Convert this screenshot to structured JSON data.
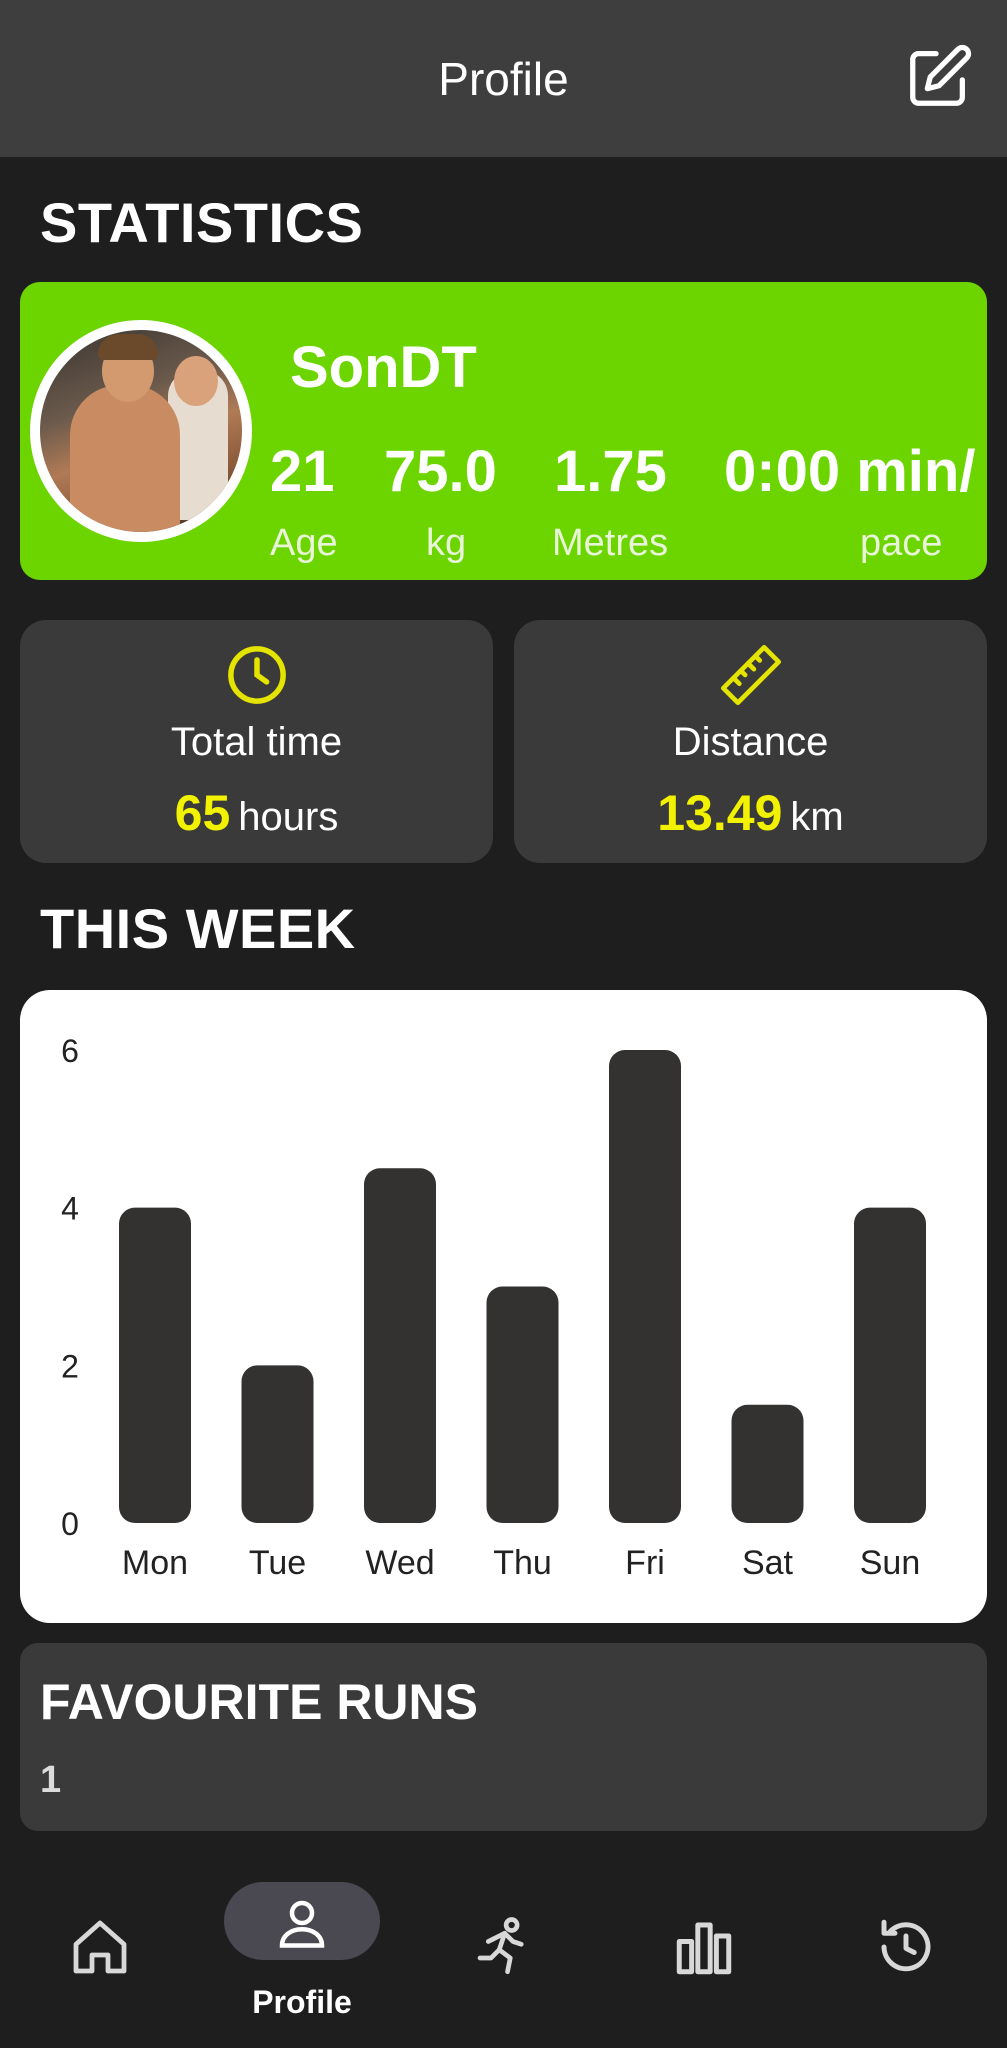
{
  "header": {
    "title": "Profile",
    "edit_icon": "edit-icon"
  },
  "statistics": {
    "section_title": "STATISTICS",
    "username": "SonDT",
    "stats": [
      {
        "value": "21",
        "label": "Age"
      },
      {
        "value": "75.0",
        "label": "kg"
      },
      {
        "value": "1.75",
        "label": "Metres"
      },
      {
        "value": "0:00 min/",
        "label": "pace"
      }
    ],
    "card_color": "#6cd500"
  },
  "tiles": {
    "total_time": {
      "label": "Total time",
      "value": "65",
      "unit": "hours",
      "icon": "clock-icon"
    },
    "distance": {
      "label": "Distance",
      "value": "13.49",
      "unit": "km",
      "icon": "ruler-icon"
    },
    "accent_color": "#f2f200"
  },
  "this_week": {
    "section_title": "THIS WEEK",
    "chart_data": {
      "type": "bar",
      "categories": [
        "Mon",
        "Tue",
        "Wed",
        "Thu",
        "Fri",
        "Sat",
        "Sun"
      ],
      "values": [
        4,
        2,
        4.5,
        3,
        6,
        1.5,
        4
      ],
      "yticks": [
        0,
        2,
        4,
        6
      ],
      "ylim": [
        0,
        6
      ],
      "bar_color": "#333230"
    }
  },
  "favourite_runs": {
    "title": "FAVOURITE RUNS",
    "count": "1"
  },
  "nav": {
    "items": [
      {
        "icon": "home-icon",
        "label": ""
      },
      {
        "icon": "profile-icon",
        "label": "Profile",
        "active": true
      },
      {
        "icon": "run-icon",
        "label": ""
      },
      {
        "icon": "bar-chart-icon",
        "label": ""
      },
      {
        "icon": "history-icon",
        "label": ""
      }
    ]
  }
}
